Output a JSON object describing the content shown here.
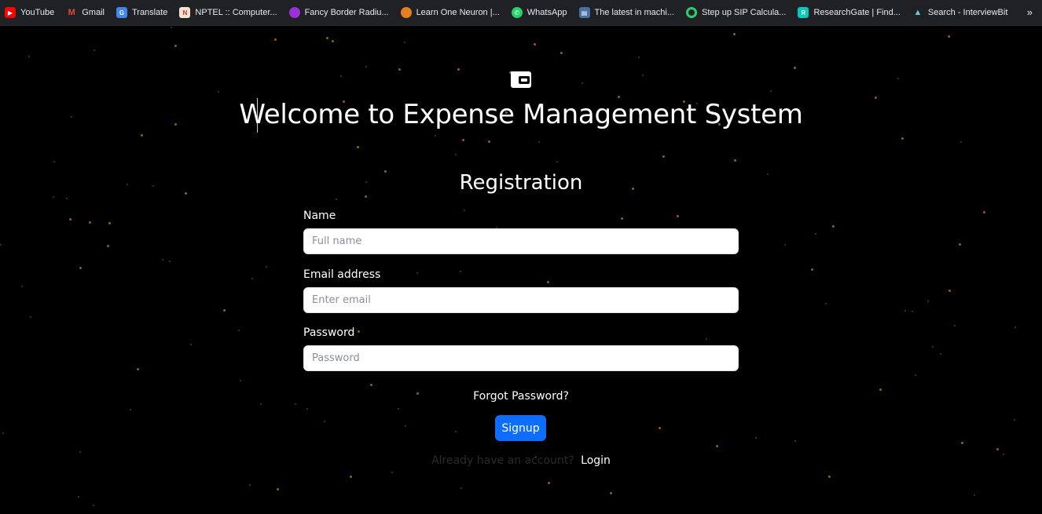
{
  "bookmarks": [
    {
      "label": "YouTube",
      "icon": "youtube-icon",
      "color": "#ff0000"
    },
    {
      "label": "Gmail",
      "icon": "gmail-icon",
      "color": "#ea4335"
    },
    {
      "label": "Translate",
      "icon": "translate-icon",
      "color": "#4285f4"
    },
    {
      "label": "NPTEL :: Computer...",
      "icon": "nptel-icon",
      "color": "#c0392b"
    },
    {
      "label": "Fancy Border Radiu...",
      "icon": "fancy-border-icon",
      "color": "#9b30d9"
    },
    {
      "label": "Learn One Neuron |...",
      "icon": "neuron-icon",
      "color": "#e67e22"
    },
    {
      "label": "WhatsApp",
      "icon": "whatsapp-icon",
      "color": "#25d366"
    },
    {
      "label": "The latest in machi...",
      "icon": "papers-icon",
      "color": "#4a6fa5"
    },
    {
      "label": "Step up SIP Calcula...",
      "icon": "sip-icon",
      "color": "#2ecc71"
    },
    {
      "label": "ResearchGate | Find...",
      "icon": "researchgate-icon",
      "color": "#00ccbb"
    },
    {
      "label": "Search - InterviewBit",
      "icon": "interviewbit-icon",
      "color": "#6cc3e0"
    }
  ],
  "more_label": "»",
  "app": {
    "title": "Welcome to Expense Management System",
    "logo_icon": "wallet-icon"
  },
  "form": {
    "heading": "Registration",
    "name_label": "Name",
    "name_placeholder": "Full name",
    "email_label": "Email address",
    "email_placeholder": "Enter email",
    "password_label": "Password",
    "password_placeholder": "Password",
    "forgot_label": "Forgot Password?",
    "signup_label": "Signup",
    "account_text": "Already have an account?",
    "login_label": "Login"
  },
  "colors": {
    "background": "#000000",
    "primary": "#0d6efd",
    "star": "#b8860b"
  }
}
